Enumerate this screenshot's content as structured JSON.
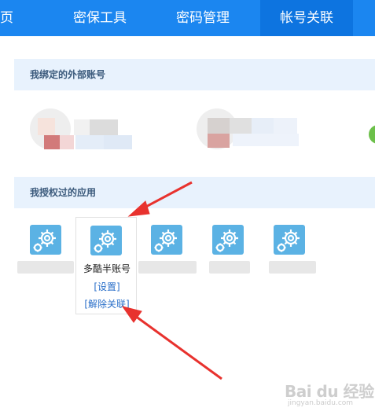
{
  "nav": {
    "tabs": [
      {
        "label": "页"
      },
      {
        "label": "密保工具"
      },
      {
        "label": "密码管理"
      },
      {
        "label": "帐号关联",
        "active": true
      },
      {
        "label": ""
      }
    ]
  },
  "sections": {
    "bound": {
      "title": "我绑定的外部账号"
    },
    "authorized": {
      "title": "我授权过的应用"
    }
  },
  "apps": {
    "selected": {
      "name": "多酷半账号",
      "settings": "[设置]",
      "unlink": "[解除关联]"
    }
  },
  "watermark": {
    "text": "Bai du 经验",
    "sub": "jingyan.baidu.com"
  },
  "colors": {
    "nav_bg": "#1b86f0",
    "nav_active": "#0d74e0",
    "section_bg": "#e8f2fd",
    "gear_bg": "#5bb2e4",
    "link": "#2a6fc9",
    "arrow": "#e8322e"
  }
}
